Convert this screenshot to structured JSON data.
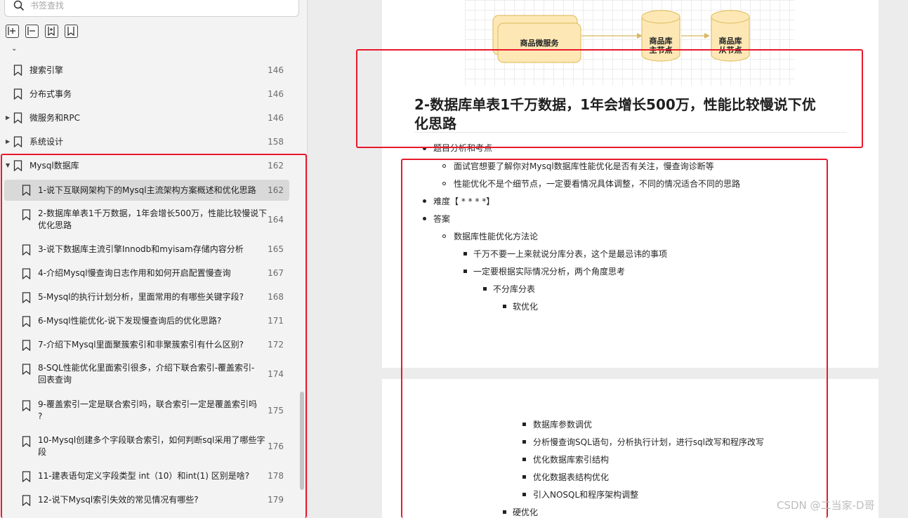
{
  "search": {
    "placeholder": "书签查找"
  },
  "toc": {
    "items": [
      {
        "label": "搜索引擎",
        "page": "146"
      },
      {
        "label": "分布式事务",
        "page": "146"
      },
      {
        "label": "微服务和RPC",
        "page": "146"
      },
      {
        "label": "系统设计",
        "page": "158"
      },
      {
        "label": "Mysql数据库",
        "page": "162"
      },
      {
        "label": "1-说下互联网架构下的Mysql主流架构方案概述和优化思路",
        "page": "162"
      },
      {
        "label1": "2-数据库单表1千万数据，1年会增长500万，性能比较慢说下",
        "label2": "优化思路",
        "page": "164"
      },
      {
        "label": "3-说下数据库主流引擎Innodb和myisam存储内容分析",
        "page": "165"
      },
      {
        "label": "4-介绍Mysql慢查询日志作用和如何开启配置慢查询",
        "page": "167"
      },
      {
        "label": "5-Mysql的执行计划分析，里面常用的有哪些关键字段?",
        "page": "168"
      },
      {
        "label": "6-Mysql性能优化-说下发现慢查询后的优化思路?",
        "page": "171"
      },
      {
        "label": "7-介绍下Mysql里面聚簇索引和非聚簇索引有什么区别?",
        "page": "172"
      },
      {
        "label1": "8-SQL性能优化里面索引很多，介绍下联合索引-覆盖索引-",
        "label2": "回表查询",
        "page": "174"
      },
      {
        "label1": "9-覆盖索引一定是联合索引吗，联合索引一定是覆盖索引吗",
        "label2": "?",
        "page": "175"
      },
      {
        "label1": "10-Mysql创建多个字段联合索引，如何判断sql采用了哪些字",
        "label2": "段",
        "page": "176"
      },
      {
        "label": "11-建表语句定义字段类型 int（10）和int(1) 区别是啥?",
        "page": "178"
      },
      {
        "label": "12-说下Mysql索引失效的常见情况有哪些?",
        "page": "179"
      }
    ]
  },
  "diagram": {
    "service": "商品微服务",
    "master_line1": "商品库",
    "master_line2": "主节点",
    "slave_line1": "商品库",
    "slave_line2": "从节点"
  },
  "doc": {
    "heading_line1": "2-数据库单表1千万数据，1年会增长500万，性能比较慢说下优",
    "heading_line2": "化思路",
    "b1": "题目分析和考点",
    "b1_1": "面试官想要了解你对Mysql数据库性能优化是否有关注，慢查询诊断等",
    "b1_2": "性能优化不是个细节点，一定要看情况具体调整，不同的情况适合不同的思路",
    "b2": "难度【 * * * *】",
    "b3": "答案",
    "b3_1": "数据库性能优化方法论",
    "b3_1_1": "千万不要一上来就说分库分表，这个是最忌讳的事项",
    "b3_1_2": "一定要根据实际情况分析，两个角度思考",
    "b3_1_2_1": "不分库分表",
    "b3_1_2_1_1": "软优化",
    "p2_1": "数据库参数调优",
    "p2_2": "分析慢查询SQL语句，分析执行计划，进行sql改写和程序改写",
    "p2_3": "优化数据库索引结构",
    "p2_4": "优化数据表结构优化",
    "p2_5": "引入NOSQL和程序架构调整",
    "p2_6": "硬优化"
  },
  "watermark": "CSDN @二当家-D哥",
  "colors": {
    "highlight_box": "#e8192c",
    "diagram_fill": "#fde8b5",
    "diagram_stroke": "#e3c26b"
  }
}
